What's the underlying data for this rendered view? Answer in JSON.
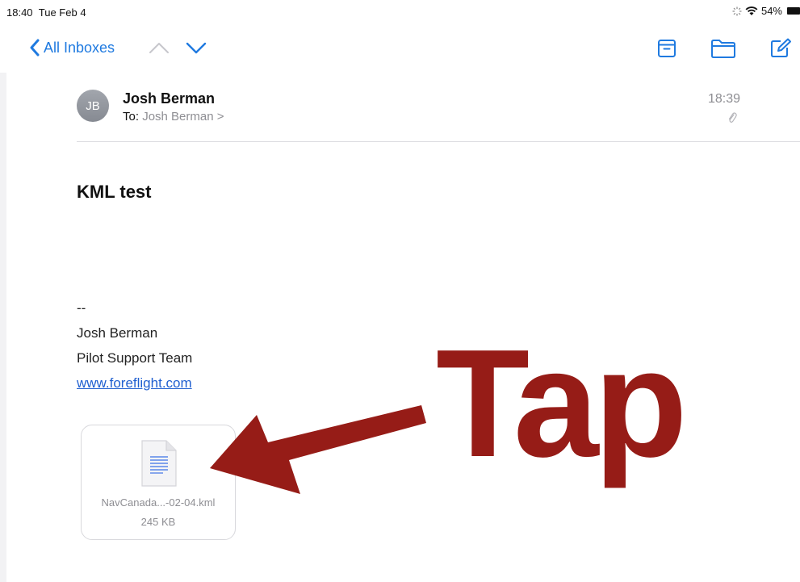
{
  "status_bar": {
    "time": "18:40",
    "date": "Tue Feb 4",
    "battery_percent": "54%",
    "icons": [
      "loading-icon",
      "wifi-icon",
      "battery-icon"
    ]
  },
  "nav": {
    "back_label": "All Inboxes",
    "icons": [
      "chevron-left-icon",
      "chevron-up-icon",
      "chevron-down-icon",
      "archive-icon",
      "folder-icon",
      "compose-icon"
    ],
    "accent_color": "#1f7ae0"
  },
  "message": {
    "avatar_initials": "JB",
    "sender": "Josh Berman",
    "to_prefix": "To:",
    "to_name": "Josh Berman >",
    "time": "18:39",
    "subject": "KML test",
    "signature": {
      "dashes": "--",
      "name": "Josh Berman",
      "team": "Pilot Support Team",
      "website": "www.foreflight.com"
    },
    "attachment": {
      "name": "NavCanada...-02-04.kml",
      "size": "245 KB"
    }
  },
  "overlay": {
    "label": "Tap",
    "color": "#961c17"
  }
}
